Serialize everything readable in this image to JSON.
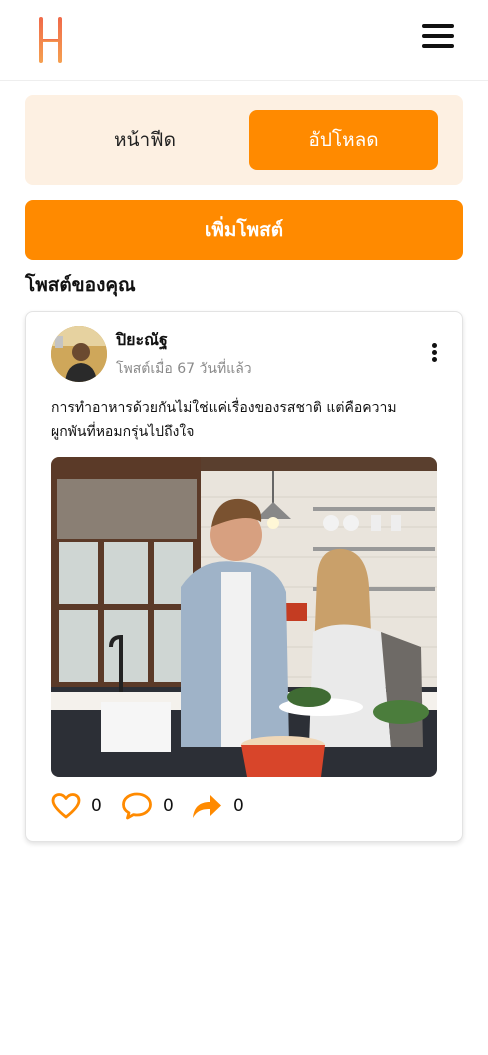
{
  "header": {
    "logo_icon": "letter-h-logo",
    "menu_icon": "hamburger-menu-icon"
  },
  "tabs": {
    "feed_label": "หน้าฟีด",
    "upload_label": "อัปโหลด",
    "active": "upload"
  },
  "add_post_label": "เพิ่มโพสต์",
  "section_title": "โพสต์ของคุณ",
  "post": {
    "author": "ปิยะณัฐ",
    "time": "โพสต์เมื่อ 67 วันที่แล้ว",
    "text": "การทำอาหารด้วยกันไม่ใช่แค่เรื่องของรสชาติ แต่คือความผูกพันที่หอมกรุ่นไปถึงใจ",
    "like_count": "0",
    "comment_count": "0",
    "share_count": "0"
  },
  "colors": {
    "accent": "#ff8a00",
    "tab_bg": "#fdf0e2"
  }
}
